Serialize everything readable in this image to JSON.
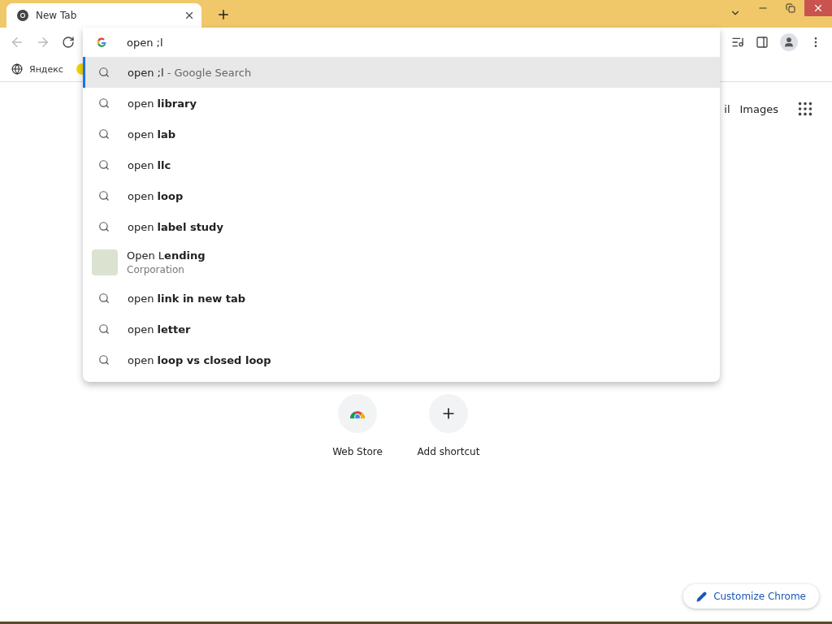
{
  "tab": {
    "title": "New Tab"
  },
  "omnibox": {
    "value": "open ;l"
  },
  "bookmarks": [
    {
      "label": "Яндекс"
    }
  ],
  "suggestions": [
    {
      "kind": "search",
      "text": "open ;l",
      "suffix": " - Google Search",
      "selected": true
    },
    {
      "kind": "search",
      "text": "open **library**",
      "selected": false
    },
    {
      "kind": "search",
      "text": "open **lab**",
      "selected": false
    },
    {
      "kind": "search",
      "text": "open **llc**",
      "selected": false
    },
    {
      "kind": "search",
      "text": "open **loop**",
      "selected": false
    },
    {
      "kind": "search",
      "text": "open **label study**",
      "selected": false
    },
    {
      "kind": "entity",
      "text": "Open L**ending**",
      "subtitle": "Corporation",
      "selected": false
    },
    {
      "kind": "search",
      "text": "open **link in new tab**",
      "selected": false
    },
    {
      "kind": "search",
      "text": "open **letter**",
      "selected": false
    },
    {
      "kind": "search",
      "text": "open **loop vs closed loop**",
      "selected": false
    }
  ],
  "header_links": [
    "il",
    "Images"
  ],
  "shortcuts": [
    {
      "kind": "webstore",
      "label": "Web Store"
    },
    {
      "kind": "add",
      "label": "Add shortcut"
    }
  ],
  "customize_button": "Customize Chrome"
}
